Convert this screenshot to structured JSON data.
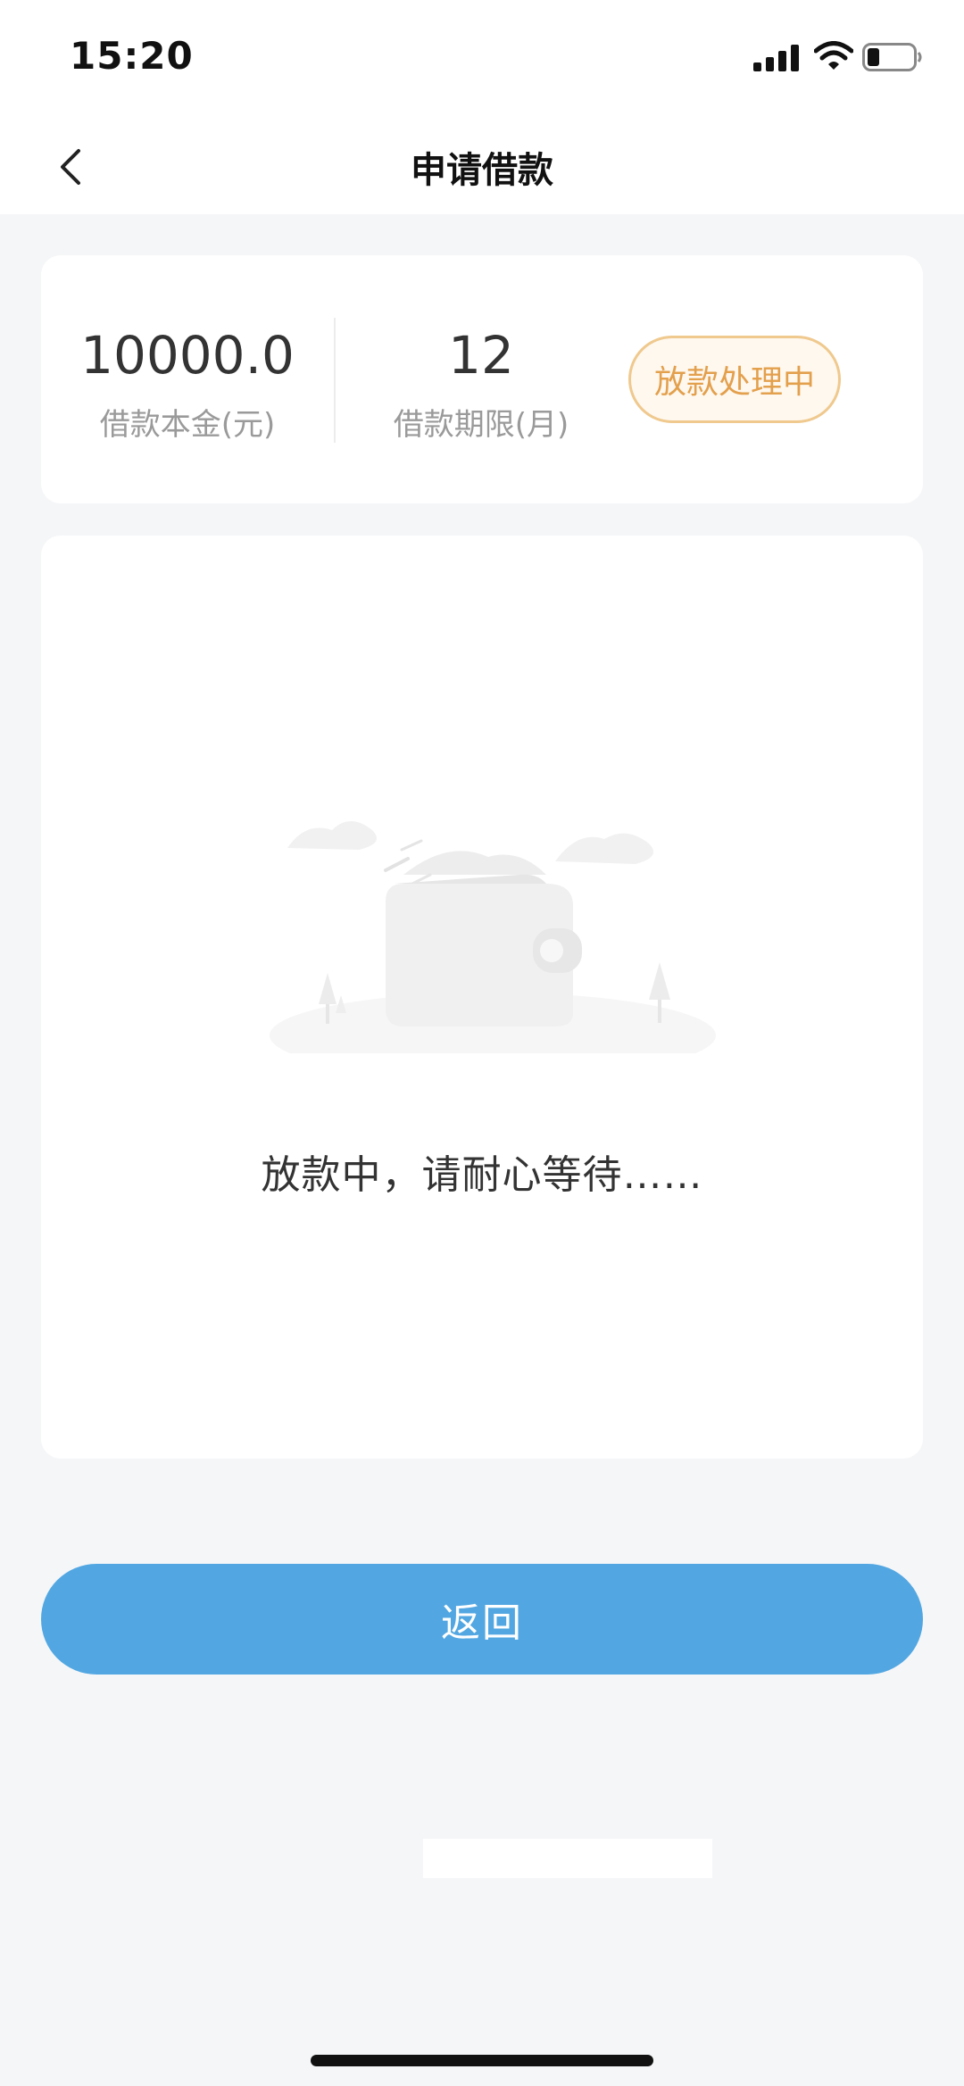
{
  "status_bar": {
    "time": "15:20",
    "icons": [
      "signal-icon",
      "wifi-icon",
      "battery-icon"
    ]
  },
  "nav": {
    "title": "申请借款",
    "back_icon": "chevron-left-icon"
  },
  "summary": {
    "amount_value": "10000.0",
    "amount_label": "借款本金(元)",
    "term_value": "12",
    "term_label": "借款期限(月)",
    "status_badge": "放款处理中"
  },
  "main": {
    "illustration": "wallet-illustration",
    "message": "放款中，请耐心等待……"
  },
  "actions": {
    "return_label": "返回"
  },
  "colors": {
    "primary_button": "#52a7e2",
    "badge_text": "#e3a04d",
    "badge_border": "#efc98e",
    "page_background": "#f5f6f8"
  }
}
